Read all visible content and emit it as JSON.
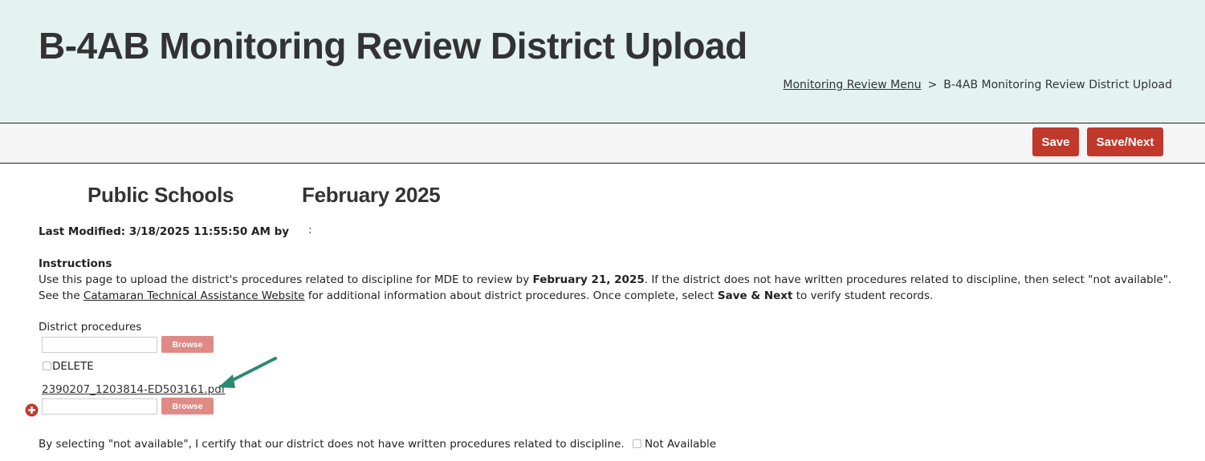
{
  "header": {
    "title": "B-4AB Monitoring Review District Upload",
    "breadcrumb": {
      "link": "Monitoring Review Menu",
      "separator": ">",
      "current": "B-4AB Monitoring Review District Upload"
    }
  },
  "toolbar": {
    "save_label": "Save",
    "save_next_label": "Save/Next"
  },
  "main": {
    "district_name": "Public Schools",
    "period": "February 2025",
    "last_modified": "Last Modified: 3/18/2025 11:55:50 AM by",
    "last_modified_suffix": ":",
    "instructions": {
      "title": "Instructions",
      "text_1": "Use this page to upload the district's procedures related to discipline for MDE to review by ",
      "deadline": "February 21, 2025",
      "text_2": ". If the district does not have written procedures related to discipline, then select \"not available\". See the ",
      "link": "Catamaran Technical Assistance Website",
      "text_3": " for additional information about district procedures. Once complete, select ",
      "save_next_bold": "Save & Next",
      "text_4": " to verify student records."
    },
    "procedures": {
      "label": "District procedures",
      "browse_label": "Browse",
      "delete_label": "DELETE",
      "file_name": "2390207_1203814-ED503161.pdf",
      "browse_label_2": "Browse"
    },
    "certify_text": "By selecting \"not available\", I certify that our district does not have written procedures related to discipline.",
    "not_available_label": "Not Available"
  },
  "colors": {
    "header_bg": "#e4f3f0",
    "button_red": "#c0392b",
    "browse_button": "#e08a86",
    "arrow": "#2a8a72"
  },
  "icons": [
    "plus-circle-icon",
    "arrow-pointer-icon"
  ]
}
